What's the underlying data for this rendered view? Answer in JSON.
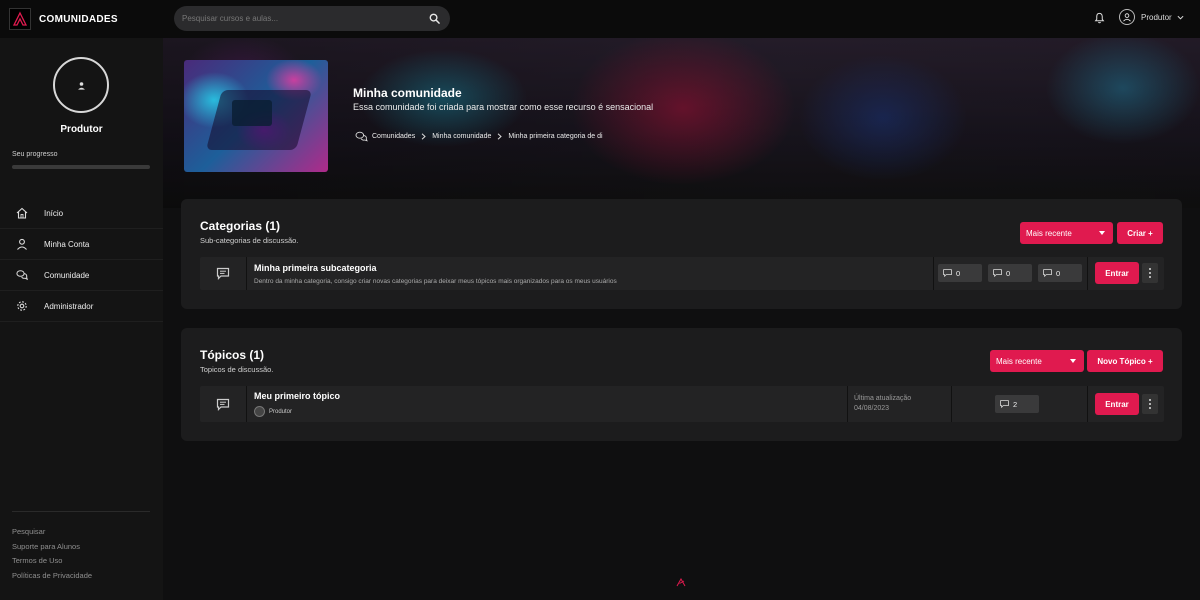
{
  "app": {
    "brand": "COMUNIDADES"
  },
  "search": {
    "placeholder": "Pesquisar cursos e aulas..."
  },
  "header": {
    "user_name": "Produtor"
  },
  "sidebar": {
    "user_name": "Produtor",
    "progress_label": "Seu progresso",
    "progress_value": 0,
    "items": [
      {
        "label": "Início",
        "icon": "home-icon"
      },
      {
        "label": "Minha Conta",
        "icon": "user-icon"
      },
      {
        "label": "Comunidade",
        "icon": "chat-icon"
      },
      {
        "label": "Administrador",
        "icon": "gear-icon"
      }
    ],
    "footer_links": [
      "Pesquisar",
      "Suporte para Alunos",
      "Termos de Uso",
      "Políticas de Privacidade"
    ]
  },
  "hero": {
    "title": "Minha comunidade",
    "description": "Essa comunidade foi criada para mostrar como esse recurso é sensacional",
    "breadcrumbs": [
      "Comunidades",
      "Minha comunidade",
      "Minha primeira categoria de di"
    ]
  },
  "categories": {
    "title": "Categorias (1)",
    "subtitle": "Sub-categorias de discussão.",
    "sort_label": "Mais recente",
    "create_label": "Criar +",
    "items": [
      {
        "title": "Minha primeira subcategoria",
        "description": "Dentro da minha categoria, consigo criar novas categorias para deixar meus tópicos mais organizados para os meus usuários",
        "stats": [
          "0",
          "0",
          "0"
        ],
        "enter_label": "Entrar"
      }
    ]
  },
  "topics": {
    "title": "Tópicos (1)",
    "subtitle": "Topicos de discussão.",
    "sort_label": "Mais recente",
    "create_label": "Novo Tópico +",
    "items": [
      {
        "title": "Meu primeiro tópico",
        "author": "Produtor",
        "updated_label": "Última atualização",
        "updated_date": "04/08/2023",
        "comments": "2",
        "enter_label": "Entrar"
      }
    ]
  },
  "colors": {
    "accent": "#e01a4f",
    "background": "#0f0f10",
    "card": "#1c1c1d"
  }
}
